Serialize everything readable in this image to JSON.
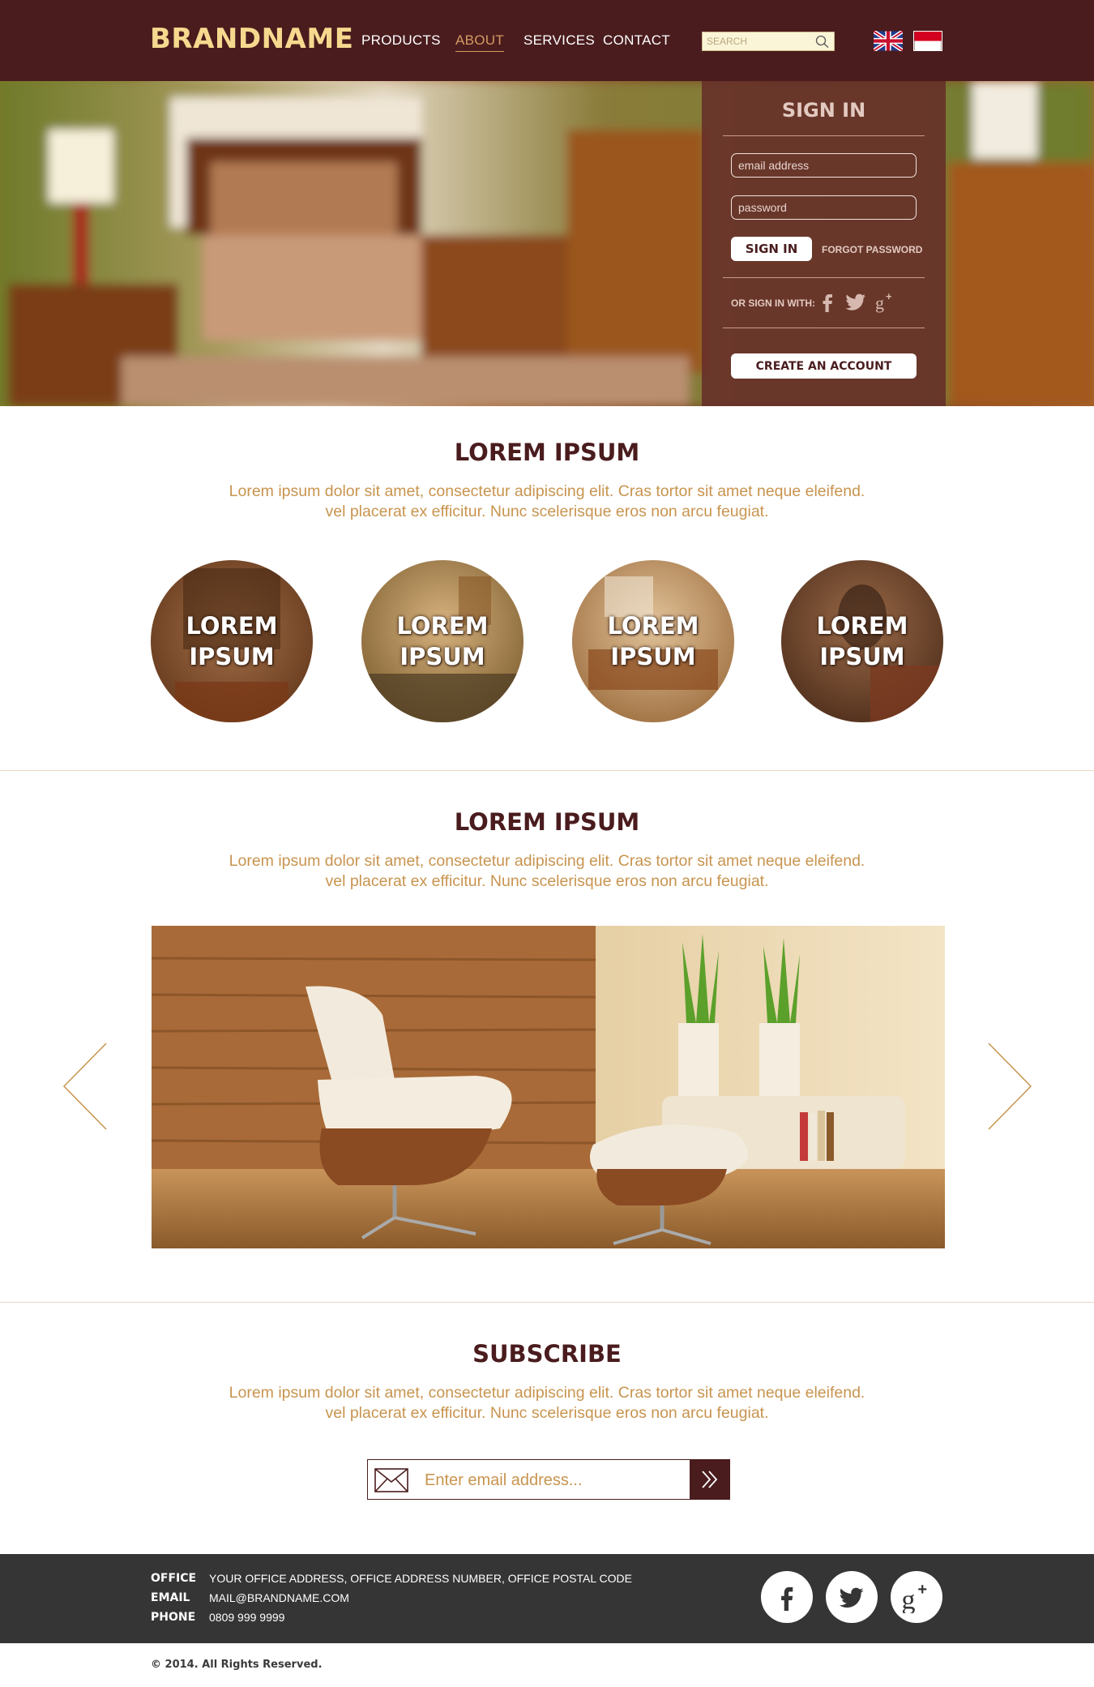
{
  "header": {
    "brand": "BRANDNAME",
    "nav": [
      {
        "label": "PRODUCTS",
        "active": false
      },
      {
        "label": "ABOUT",
        "active": true
      },
      {
        "label": "SERVICES",
        "active": false
      },
      {
        "label": "CONTACT",
        "active": false
      }
    ],
    "search_placeholder": "SEARCH",
    "languages": [
      "uk-flag",
      "indonesia-flag"
    ]
  },
  "signin": {
    "title": "SIGN IN",
    "email_placeholder": "email address",
    "password_placeholder": "password",
    "signin_label": "SIGN IN",
    "forgot_label": "FORGOT PASSWORD",
    "or_label": "OR SIGN IN WITH:",
    "social": [
      "facebook-icon",
      "twitter-icon",
      "google-plus-icon"
    ],
    "create_label": "CREATE AN ACCOUNT"
  },
  "section1": {
    "title": "LOREM IPSUM",
    "text_line1": "Lorem ipsum dolor sit amet, consectetur adipiscing elit. Cras  tortor sit amet neque eleifend.",
    "text_line2": "vel placerat ex efficitur. Nunc scelerisque eros non arcu feugiat.",
    "circles": [
      {
        "line1": "LOREM",
        "line2": "IPSUM"
      },
      {
        "line1": "LOREM",
        "line2": "IPSUM"
      },
      {
        "line1": "LOREM",
        "line2": "IPSUM"
      },
      {
        "line1": "LOREM",
        "line2": "IPSUM"
      }
    ]
  },
  "section2": {
    "title": "LOREM IPSUM",
    "text_line1": "Lorem ipsum dolor sit amet, consectetur adipiscing elit. Cras  tortor sit amet neque eleifend.",
    "text_line2": "vel placerat ex efficitur. Nunc scelerisque eros non arcu feugiat."
  },
  "subscribe": {
    "title": "SUBSCRIBE",
    "text_line1": "Lorem ipsum dolor sit amet, consectetur adipiscing elit. Cras  tortor sit amet neque eleifend.",
    "text_line2": "vel placerat ex efficitur. Nunc scelerisque eros non arcu feugiat.",
    "input_placeholder": "Enter email address..."
  },
  "footer": {
    "office_label": "OFFICE",
    "office_value": "YOUR OFFICE ADDRESS, OFFICE ADDRESS NUMBER, OFFICE POSTAL CODE",
    "email_label": "EMAIL",
    "email_value": "MAIL@BRANDNAME.COM",
    "phone_label": "PHONE",
    "phone_value": "0809 999 9999",
    "copyright": "© 2014. All Rights Reserved."
  },
  "colors": {
    "header_bg": "#4a1c1e",
    "brand": "#f6d98e",
    "accent_text": "#c8944f",
    "footer_bg": "#353535"
  }
}
